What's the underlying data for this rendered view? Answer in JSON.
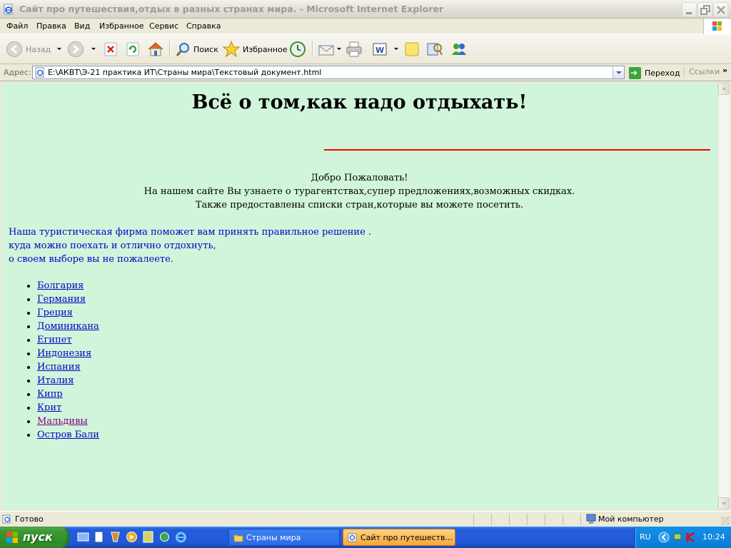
{
  "window": {
    "title": "Сайт про путешествия,отдых в разных странах мира. - Microsoft Internet Explorer"
  },
  "menu": [
    "Файл",
    "Правка",
    "Вид",
    "Избранное",
    "Сервис",
    "Справка"
  ],
  "toolbar": {
    "back_label": "Назад",
    "search_label": "Поиск",
    "favorites_label": "Избранное"
  },
  "address": {
    "label": "Адрес:",
    "url": "E:\\АКВТ\\Э-21 практика ИТ\\Страны мира\\Текстовый документ.html",
    "go_label": "Переход",
    "links_label": "Ссылки",
    "more": "»"
  },
  "page": {
    "heading": "Всё о том,как надо отдыхать!",
    "welcome": [
      "Добро Пожаловать!",
      "На нашем сайте Вы узнаете о турагентствах,супер предложениях,возможных скидках.",
      "Также предоставлены списки стран,которые вы можете посетить."
    ],
    "intro": [
      "Наша туристическая фирма поможет вам принять правильное решение .",
      "куда можно поехать и отлично отдохнуть,",
      "о своем выборе вы не пожалеете."
    ],
    "countries": [
      {
        "name": "Болгария",
        "visited": false
      },
      {
        "name": "Германия",
        "visited": false
      },
      {
        "name": "Греция",
        "visited": false
      },
      {
        "name": "Доминикана",
        "visited": false
      },
      {
        "name": "Египет",
        "visited": false
      },
      {
        "name": "Индонезия",
        "visited": false
      },
      {
        "name": "Испания",
        "visited": false
      },
      {
        "name": "Италия",
        "visited": false
      },
      {
        "name": "Кипр",
        "visited": false
      },
      {
        "name": "Крит",
        "visited": false
      },
      {
        "name": "Мальдивы",
        "visited": true
      },
      {
        "name": "Остров Бали",
        "visited": false
      }
    ]
  },
  "status": {
    "text": "Готово",
    "zone": "Мой компьютер"
  },
  "taskbar": {
    "start_label": "пуск",
    "tasks": [
      "Страны мира",
      "Сайт про путешеств..."
    ],
    "lang": "RU",
    "clock": "10:24"
  },
  "colors": {
    "page_background": "#d0f5da",
    "divider": "#ff0000",
    "link": "#0000c8",
    "visited_link": "#800080"
  }
}
